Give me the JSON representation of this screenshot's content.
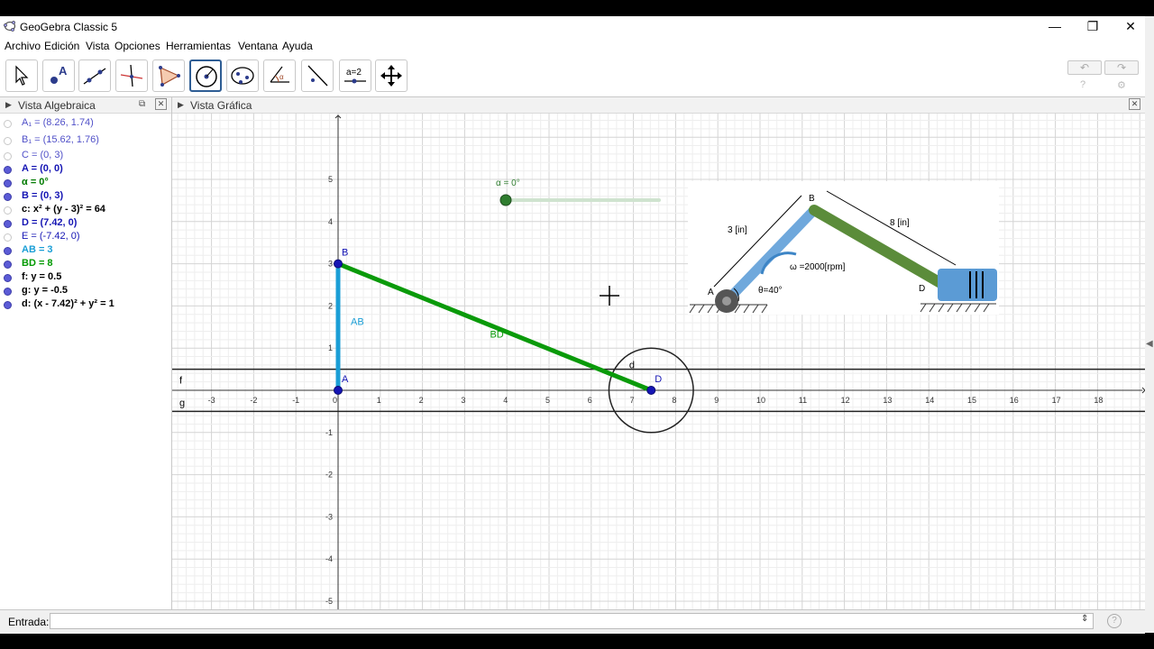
{
  "window": {
    "title": "GeoGebra Classic 5",
    "minimize": "—",
    "restore": "❐",
    "close": "✕"
  },
  "menu": [
    "Archivo",
    "Edición",
    "Vista",
    "Opciones",
    "Herramientas",
    "Ventana",
    "Ayuda"
  ],
  "toolbar": {
    "tools": [
      "move-tool",
      "point-tool",
      "line-tool",
      "perpendicular-tool",
      "polygon-tool",
      "circle-tool",
      "conic-tool",
      "angle-tool",
      "reflect-tool",
      "slider-tool",
      "move-view-tool"
    ],
    "active_tool": "circle-tool",
    "undo": "↶",
    "redo": "↷",
    "help": "?",
    "settings": "⚙"
  },
  "algebra": {
    "title": "Vista Algebraica",
    "items": [
      {
        "label": "A₁ = (8.26, 1.74)",
        "color": "#5050c8",
        "shown": false,
        "bold": false
      },
      {
        "label": "B₁ = (15.62, 1.76)",
        "color": "#5050c8",
        "shown": false,
        "bold": false
      },
      {
        "label": "C = (0, 3)",
        "color": "#5050c8",
        "shown": false,
        "bold": false
      },
      {
        "label": "A = (0, 0)",
        "color": "#1515b4",
        "shown": true,
        "bold": true
      },
      {
        "label": "α = 0°",
        "color": "#007a00",
        "shown": true,
        "bold": true
      },
      {
        "label": "B = (0, 3)",
        "color": "#1515b4",
        "shown": true,
        "bold": true
      },
      {
        "label": "c: x² + (y - 3)² = 64",
        "color": "#000000",
        "shown": false,
        "bold": true
      },
      {
        "label": "D = (7.42, 0)",
        "color": "#1515b4",
        "shown": true,
        "bold": true
      },
      {
        "label": "E = (-7.42, 0)",
        "color": "#1515b4",
        "shown": false,
        "bold": false
      },
      {
        "label": "AB = 3",
        "color": "#1a9ed6",
        "shown": true,
        "bold": true
      },
      {
        "label": "BD = 8",
        "color": "#009900",
        "shown": true,
        "bold": true
      },
      {
        "label": "f: y = 0.5",
        "color": "#000000",
        "shown": true,
        "bold": true
      },
      {
        "label": "g: y = -0.5",
        "color": "#000000",
        "shown": true,
        "bold": true
      },
      {
        "label": "d: (x - 7.42)² + y² = 1",
        "color": "#000000",
        "shown": true,
        "bold": true
      }
    ]
  },
  "graphics": {
    "title": "Vista Gráfica",
    "x_ticks": [
      "-3",
      "-2",
      "-1",
      "0",
      "1",
      "2",
      "3",
      "4",
      "5",
      "6",
      "7",
      "8",
      "9",
      "10",
      "11",
      "12",
      "13",
      "14",
      "15",
      "16",
      "17",
      "18"
    ],
    "y_ticks": [
      "5",
      "4",
      "3",
      "2",
      "1",
      "-1",
      "-2",
      "-3",
      "-4",
      "-5"
    ],
    "labels": {
      "A": "A",
      "B": "B",
      "D": "D",
      "AB": "AB",
      "BD": "BD",
      "f": "f",
      "g": "g",
      "d": "d"
    },
    "slider_label": "α = 0°",
    "colors": {
      "ab": "#1a9ed6",
      "bd": "#0a9a0a",
      "point": "#1515b4",
      "slider": "#2f7d2f"
    }
  },
  "figure": {
    "labels": {
      "a": "A",
      "b": "B",
      "d": "D",
      "len_ab": "3 [in]",
      "len_bd": "8 [in]",
      "omega": "ω =2000[rpm]",
      "theta": "θ=40°"
    },
    "colors": {
      "crank": "#6fa8dc",
      "rod": "#5b8c3a",
      "block": "#5b9bd5"
    }
  },
  "input": {
    "label": "Entrada:",
    "value": ""
  }
}
